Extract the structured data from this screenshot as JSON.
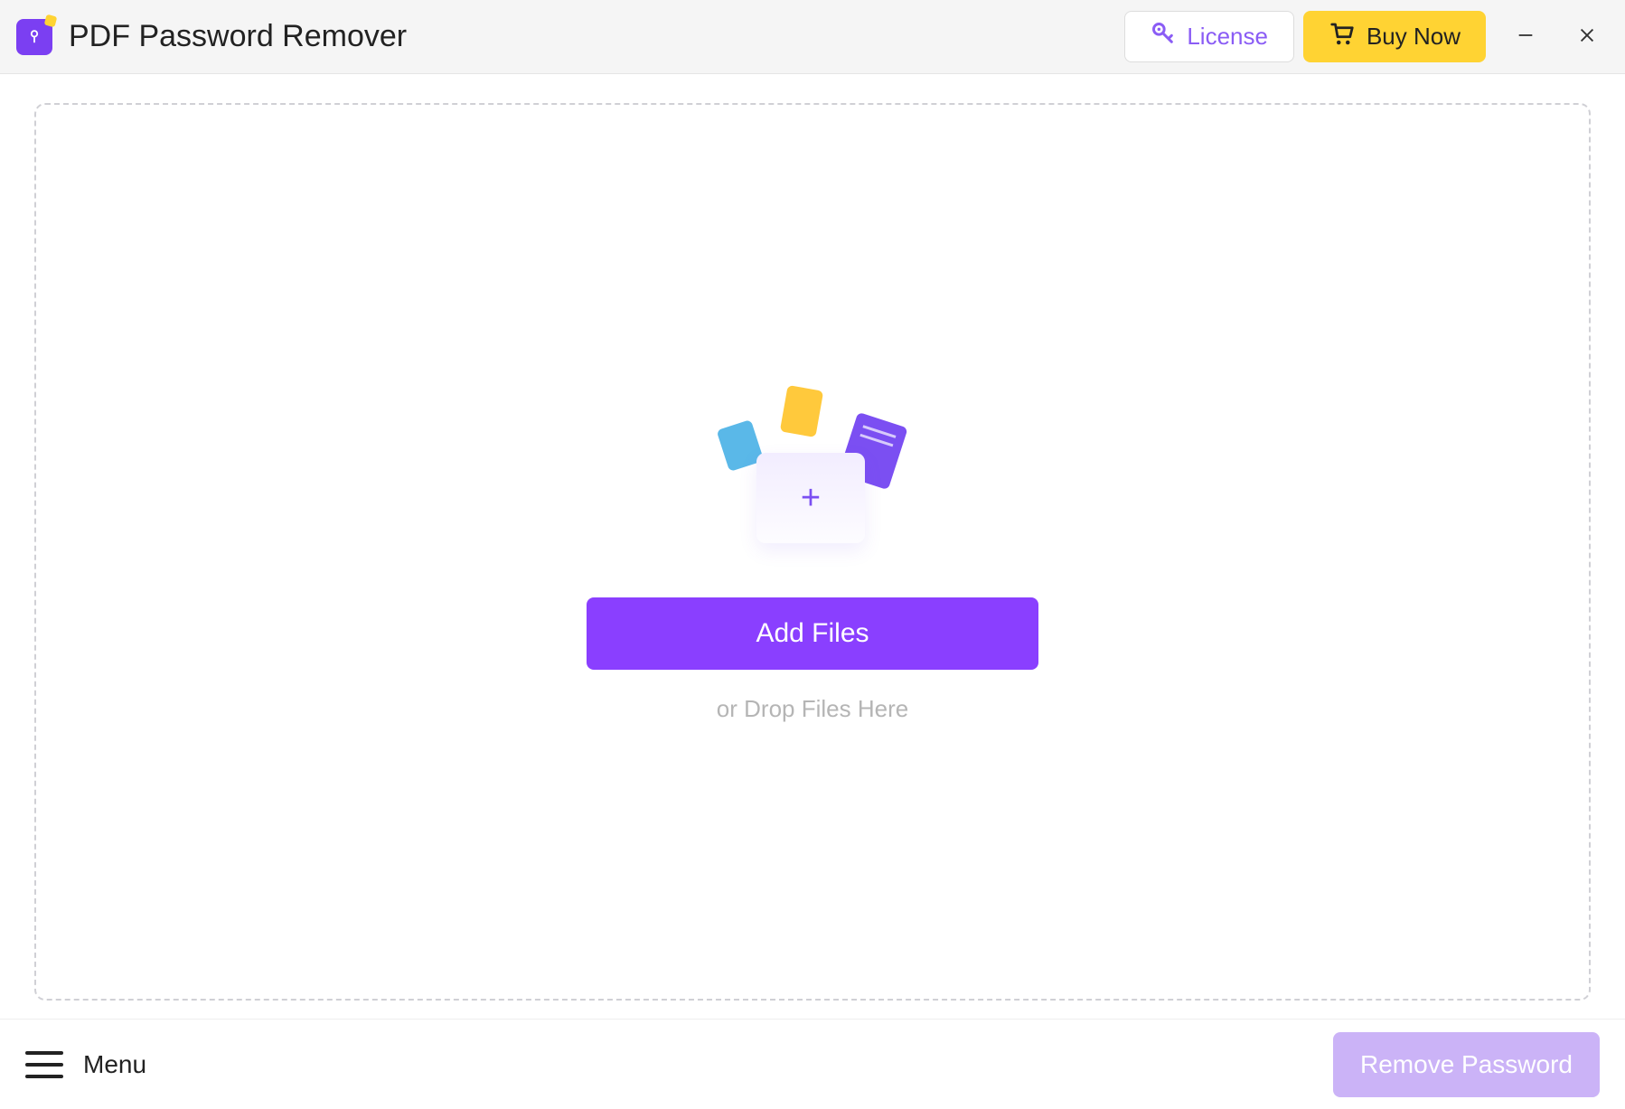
{
  "titlebar": {
    "app_title": "PDF Password Remover",
    "license_label": "License",
    "buy_now_label": "Buy Now"
  },
  "main": {
    "add_files_label": "Add Files",
    "drop_hint": "or Drop Files Here"
  },
  "footer": {
    "menu_label": "Menu",
    "remove_password_label": "Remove Password"
  },
  "colors": {
    "accent_purple": "#8a3fff",
    "accent_yellow": "#ffd333",
    "disabled_purple": "#cbb3f7"
  }
}
